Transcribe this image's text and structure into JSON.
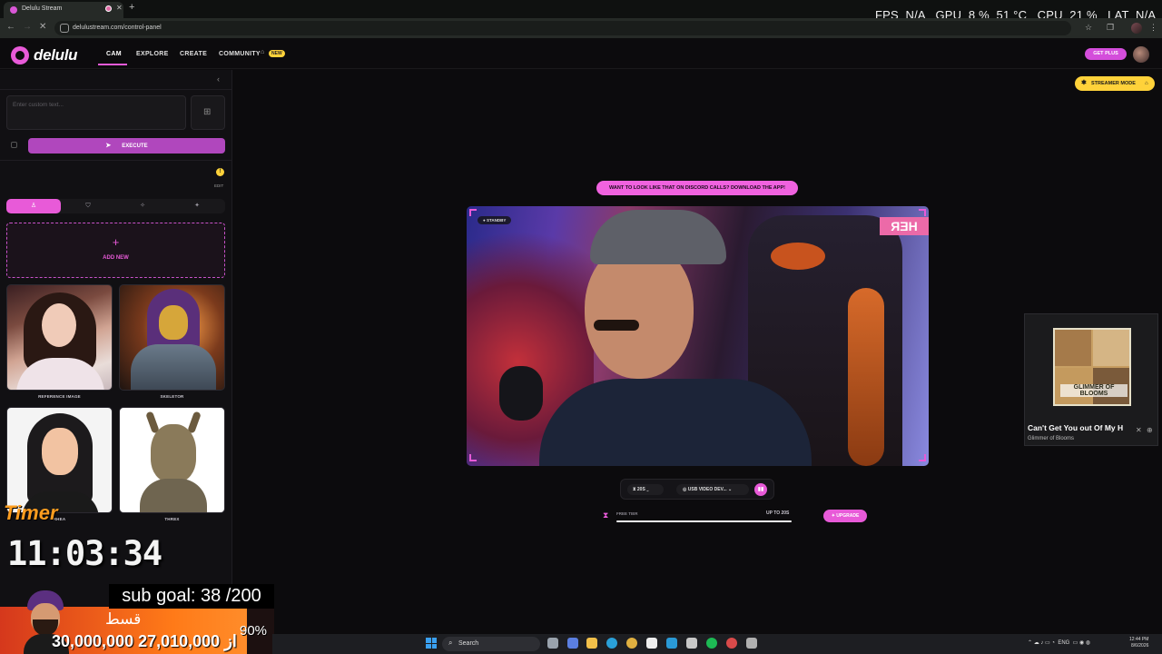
{
  "browser": {
    "tab_title": "Delulu Stream",
    "new_tab_icon": "+",
    "url": "delulustream.com/control-panel",
    "perf_overlay": "FPS  N/A   GPU  8 %  51 °C   CPU  21 %   LAT  N/A"
  },
  "header": {
    "logo": "delulu",
    "nav": [
      "CAM",
      "EXPLORE",
      "CREATE",
      "COMMUNITY"
    ],
    "new_badge": "NEW",
    "get_plus": "GET PLUS"
  },
  "left_panel": {
    "custom_text_placeholder": "Enter custom text...",
    "execute_label": "EXECUTE",
    "info_label": "EDIT",
    "add_new_label": "ADD NEW",
    "cards": [
      {
        "label": "REFERENCE IMAGE"
      },
      {
        "label": "SKELETOR"
      },
      {
        "label": "RHEA"
      },
      {
        "label": "THREX"
      }
    ]
  },
  "stream_overlay": {
    "timer_label": "Timer",
    "timer_value": "11:03:34",
    "sub_goal": "sub goal: 38 /200",
    "goal_arabic": "قسط",
    "goal_percent": "90%",
    "goal_progress": 0.9,
    "goal_amount": "30,000,000 از 27,010,000"
  },
  "main": {
    "streamer_mode": "STREAMER MODE",
    "discord_banner": "WANT TO LOOK LIKE THAT ON DISCORD CALLS? DOWNLOAD THE APP!",
    "video_status": "STANDBY",
    "video_sign_text": "ЯƎH",
    "fps_select": "20S",
    "camera_select": "USB VIDEO DEV...",
    "tier_label": "FREE TIER",
    "tier_max": "UP TO 20S",
    "tier_progress": 1.0,
    "upgrade_label": "UPGRADE"
  },
  "music": {
    "album_text": "GLIMMER OF BLOOMS",
    "track_title": "Can't Get You out Of My H",
    "artist": "Glimmer of Blooms"
  },
  "taskbar": {
    "search_label": "Search",
    "tray": "ENG",
    "clock_time": "12:44 PM",
    "clock_date": "8/6/2026"
  },
  "colors": {
    "accent": "#e85ad8",
    "highlight": "#ffd23a",
    "background": "#0c0b0d"
  }
}
